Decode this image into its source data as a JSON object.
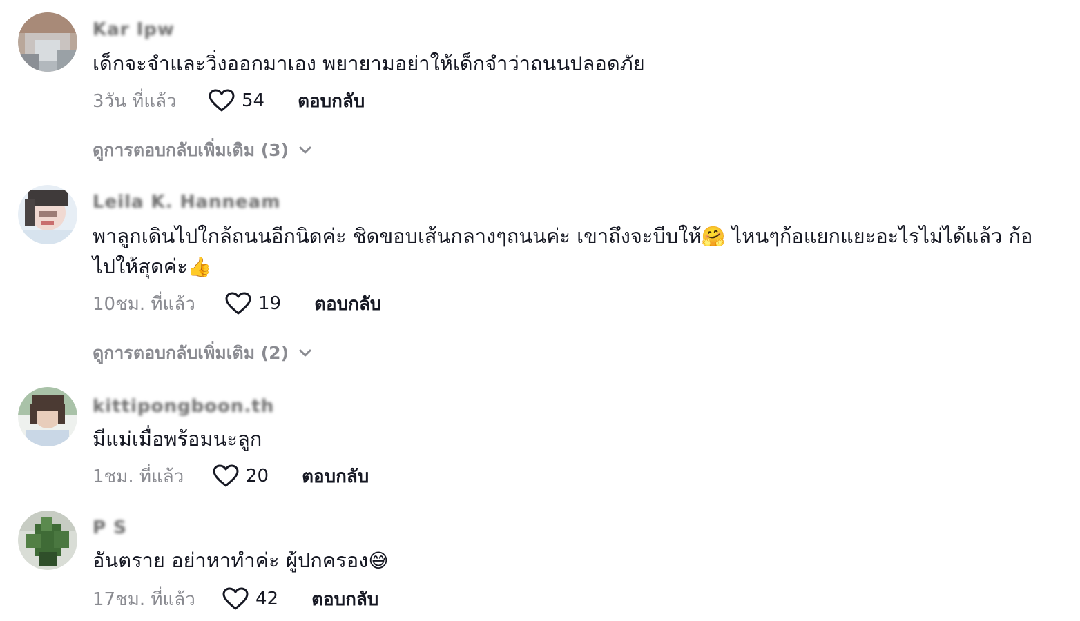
{
  "comments": [
    {
      "username": "Kar Ipw",
      "text": "เด็กจะจำและวิ่งออกมาเอง พยายามอย่าให้เด็กจำว่าถนนปลอดภัย",
      "time": "3วัน ที่แล้ว",
      "likes": "54",
      "reply_label": "ตอบกลับ",
      "more_replies": "ดูการตอบกลับเพิ่มเติม (3)"
    },
    {
      "username": "Leila K. Hanneam",
      "text_line1": "พาลูกเดินไปใกล้ถนนอีกนิดค่ะ ชิดขอบเส้นกลางๆถนนค่ะ เขาถึงจะบีบให้",
      "text_emoji1": "🤗",
      "text_line1_after": " ไหนๆก้อแยกแยะอะไรไม่ได้แล้ว ก้อ",
      "text_line2": "ไปให้สุดค่ะ",
      "text_emoji2": "👍",
      "time": "10ชม. ที่แล้ว",
      "likes": "19",
      "reply_label": "ตอบกลับ",
      "more_replies": "ดูการตอบกลับเพิ่มเติม (2)"
    },
    {
      "username": "kittipongboon.th",
      "text": "มีแม่เมื่อพร้อมนะลูก",
      "time": "1ชม. ที่แล้ว",
      "likes": "20",
      "reply_label": "ตอบกลับ"
    },
    {
      "username": "P S",
      "text": "อันตราย อย่าหาทำค่ะ ผู้ปกครอง",
      "text_emoji": "😅",
      "time": "17ชม. ที่แล้ว",
      "likes": "42",
      "reply_label": "ตอบกลับ"
    }
  ],
  "icons": {
    "like": "heart-outline-icon",
    "expand": "chevron-down-icon"
  },
  "colors": {
    "text_primary": "#161823",
    "text_secondary": "#8a8b91"
  }
}
